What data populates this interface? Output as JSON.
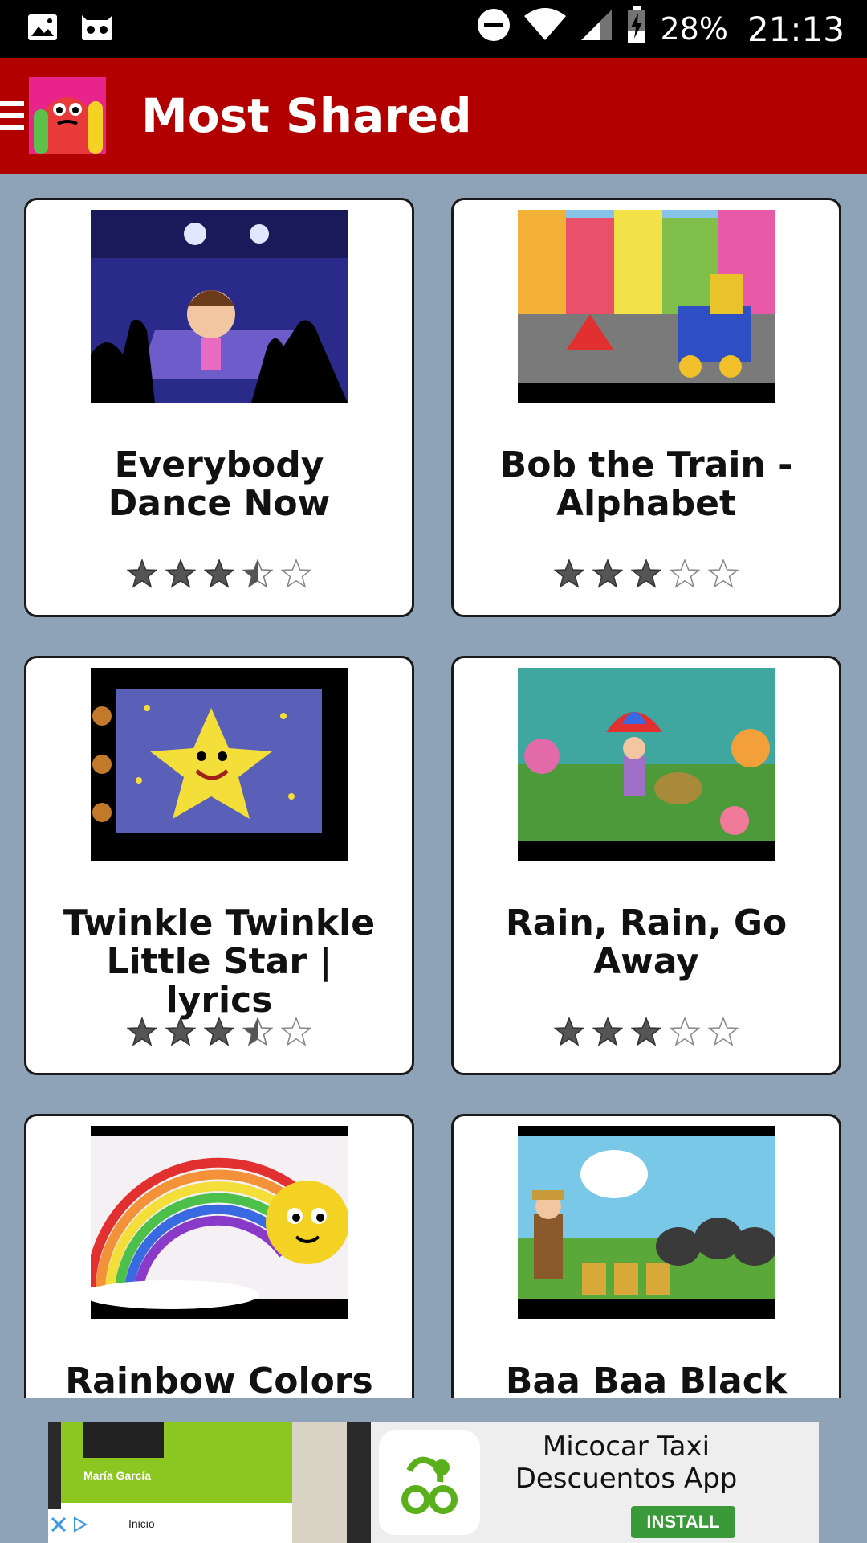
{
  "status_bar": {
    "battery_percent": "28%",
    "time": "21:13",
    "icons": [
      "image-icon",
      "cat-robot-icon",
      "do-not-disturb-icon",
      "wifi-icon",
      "signal-icon",
      "battery-charging-icon"
    ]
  },
  "app_bar": {
    "title": "Most Shared",
    "brand_color": "#b20000"
  },
  "videos": [
    {
      "title": "Everybody Dance Now",
      "rating": 3.5
    },
    {
      "title": "Bob the Train - Alphabet",
      "rating": 3
    },
    {
      "title": "Twinkle Twinkle Little Star | lyrics",
      "rating": 3.5
    },
    {
      "title": "Rain, Rain, Go Away",
      "rating": 3
    },
    {
      "title": "Rainbow Colors",
      "rating": null
    },
    {
      "title": "Baa Baa Black",
      "rating": null
    }
  ],
  "ad": {
    "left_name": "María García",
    "left_tab": "Inicio",
    "headline": "Micocar Taxi Descuentos App",
    "cta": "INSTALL"
  }
}
